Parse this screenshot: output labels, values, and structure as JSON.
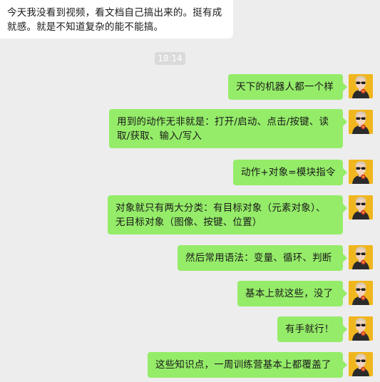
{
  "incoming_message": {
    "text": "今天我没看到视频，看文档自己搞出来的。挺有成\n就感。就是不知道复杂的能不能搞。"
  },
  "timestamp": "18:14",
  "outgoing_messages": [
    {
      "text": "天下的机器人都一个样"
    },
    {
      "text": "用到的动作无非就是：打开/启动、点击/按键、读\n取/获取、输入/写入"
    },
    {
      "text": "动作+对象=模块指令"
    },
    {
      "text": "对象就只有两大分类：有目标对象（元素对象）、\n无目标对象（图像、按键、位置）"
    },
    {
      "text": "然后常用语法：变量、循环、判断"
    },
    {
      "text": "基本上就这些，没了"
    },
    {
      "text": "有手就行！"
    },
    {
      "text": "这些知识点，一周训练营基本上都覆盖了"
    }
  ],
  "colors": {
    "background": "#ededed",
    "outgoing_bubble": "#95ec69",
    "incoming_bubble": "#ffffff",
    "avatar_background": "#f0b61e"
  },
  "icons": {
    "avatar": "person-avatar-icon"
  }
}
